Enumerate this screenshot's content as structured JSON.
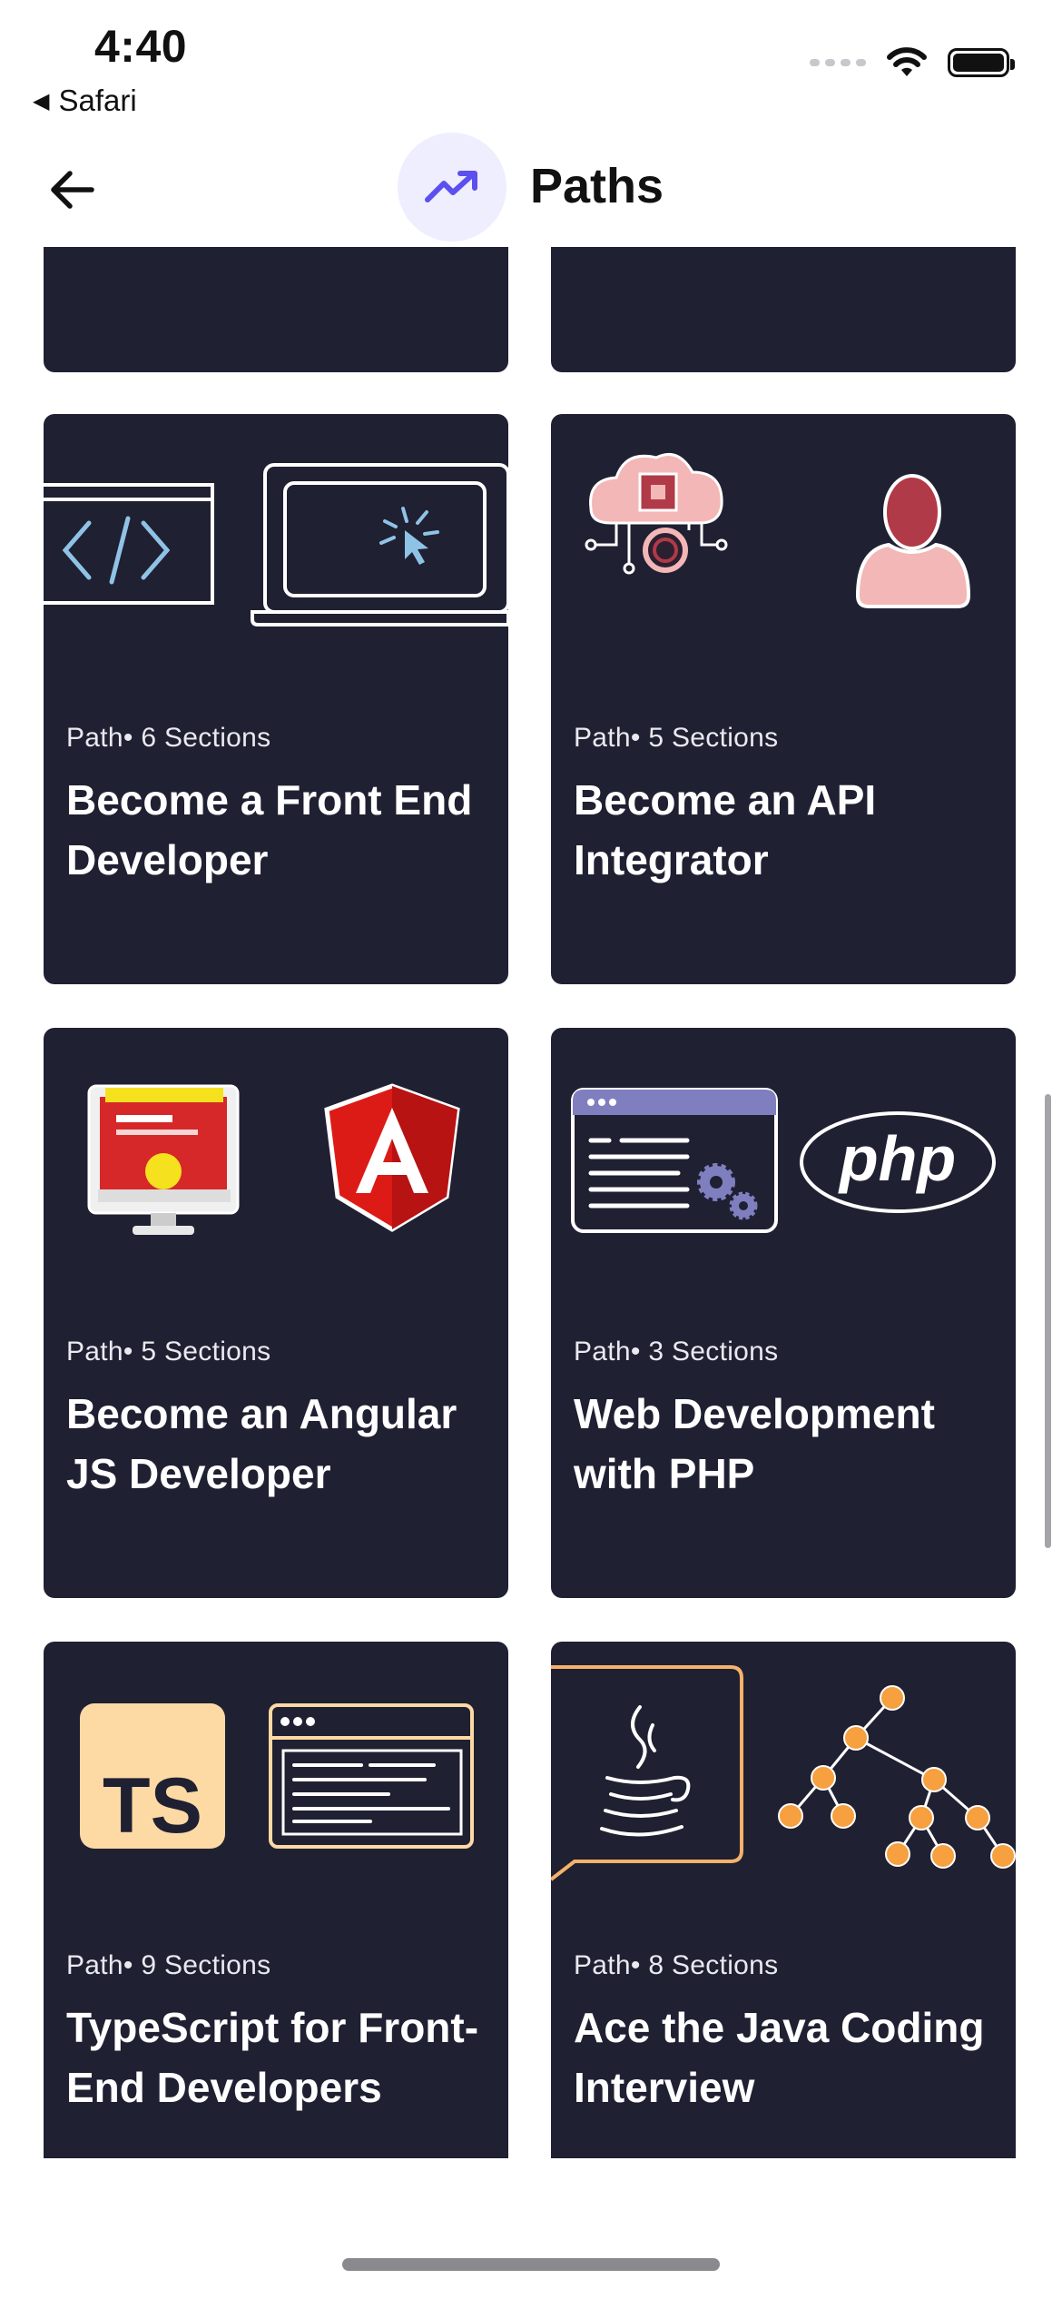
{
  "status_bar": {
    "time": "4:40",
    "back_app": "Safari",
    "back_app_icon": "back-triangle-icon",
    "signal_icon": "cellular-signal-icon",
    "wifi_icon": "wifi-icon",
    "battery_icon": "battery-icon"
  },
  "header": {
    "title": "Paths",
    "back_icon": "arrow-left-icon",
    "title_icon": "trending-up-icon",
    "accent_color": "#5b4ff0",
    "icon_bg": "#efeefe"
  },
  "theme": {
    "card_bg": "#1f2032",
    "card_text": "#ffffff"
  },
  "cards": [
    {
      "meta": "Path• 6 Sections",
      "title": "Become a Front End Developer",
      "icons": [
        "code-window-icon",
        "laptop-click-icon"
      ]
    },
    {
      "meta": "Path• 5 Sections",
      "title": "Become an API Integrator",
      "icons": [
        "cloud-chip-icon",
        "user-icon"
      ]
    },
    {
      "meta": "Path• 5 Sections",
      "title": "Become an Angular JS Developer",
      "icons": [
        "monitor-settings-icon",
        "angular-logo-icon"
      ]
    },
    {
      "meta": "Path• 3 Sections",
      "title": "Web Development with PHP",
      "icons": [
        "browser-code-icon",
        "php-logo-icon"
      ]
    },
    {
      "meta": "Path• 9 Sections",
      "title": "TypeScript for Front-End Developers",
      "icons": [
        "typescript-logo-icon",
        "browser-window-icon"
      ]
    },
    {
      "meta": "Path• 8 Sections",
      "title": "Ace the Java Coding Interview",
      "icons": [
        "java-logo-icon",
        "tree-structure-icon"
      ]
    }
  ]
}
